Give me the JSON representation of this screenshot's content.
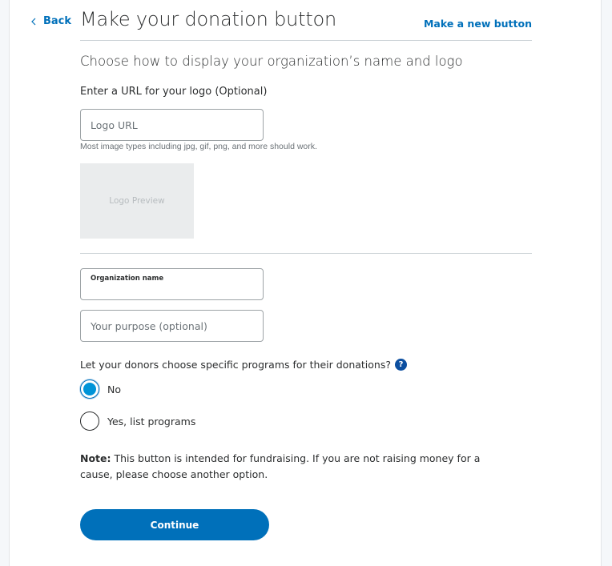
{
  "nav": {
    "back_label": "Back",
    "new_button_label": "Make a new button"
  },
  "header": {
    "title": "Make your donation button"
  },
  "section": {
    "subtitle": "Choose how to display your organization’s name and logo"
  },
  "logo": {
    "label": "Enter a URL for your logo (Optional)",
    "placeholder": "Logo URL",
    "value": "",
    "helper": "Most image types including jpg, gif, png, and more should work.",
    "preview_text": "Logo Preview"
  },
  "organization": {
    "label": "Organization name",
    "value": ""
  },
  "purpose": {
    "placeholder": "Your purpose (optional)",
    "value": ""
  },
  "programs": {
    "question": "Let your donors choose specific programs for their donations?",
    "help_icon": "?",
    "options": [
      {
        "label": "No",
        "selected": true
      },
      {
        "label": "Yes, list programs",
        "selected": false
      }
    ]
  },
  "note": {
    "prefix": "Note:",
    "text": " This button is intended for fundraising. If you are not raising money for a cause, please choose another option."
  },
  "actions": {
    "continue_label": "Continue"
  },
  "colors": {
    "accent": "#0070ba",
    "radio_fill": "#0094d8",
    "help_icon_bg": "#0c4fa0",
    "preview_bg": "#eaeced"
  }
}
